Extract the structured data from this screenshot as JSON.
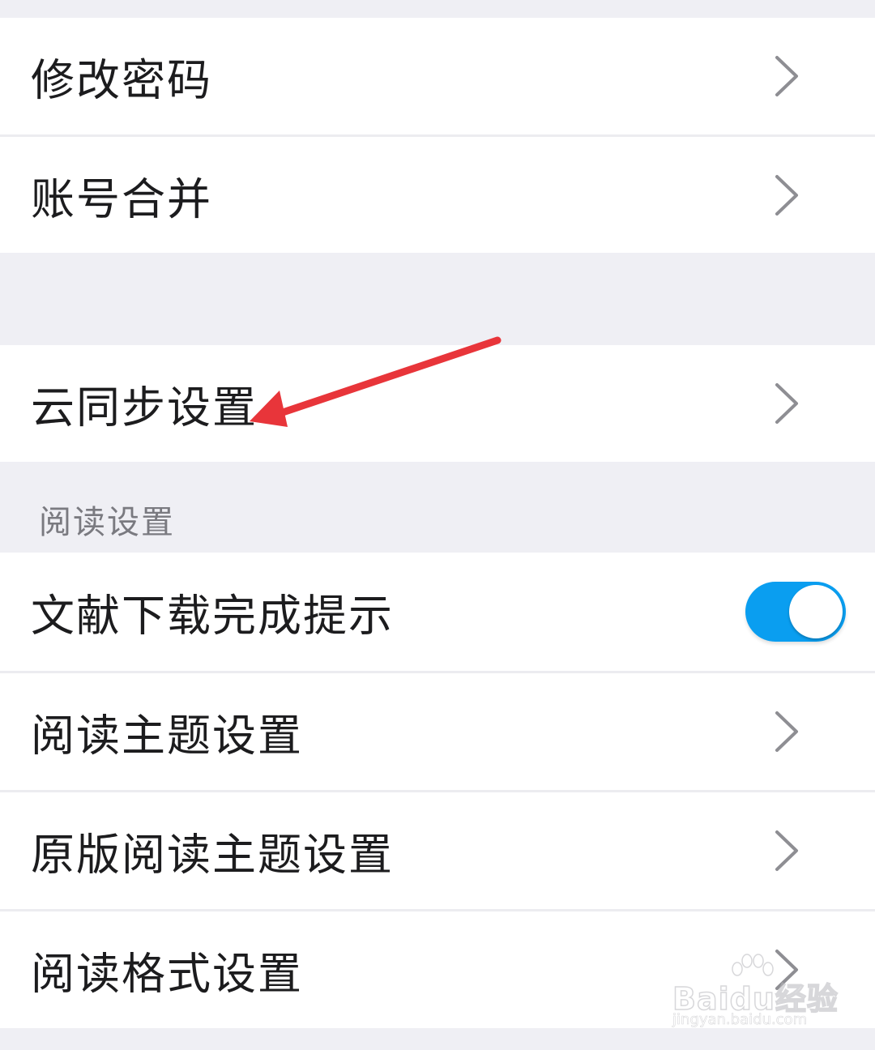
{
  "settings_list": {
    "account_items": [
      {
        "label": "修改密码"
      },
      {
        "label": "账号合并"
      }
    ],
    "cloud_sync_item": {
      "label": "云同步设置"
    },
    "reading_section": {
      "title": "阅读设置",
      "download_notify": {
        "label": "文献下载完成提示",
        "toggle_on": true
      },
      "items": [
        {
          "label": "阅读主题设置"
        },
        {
          "label": "原版阅读主题设置"
        },
        {
          "label": "阅读格式设置"
        }
      ]
    }
  },
  "colors": {
    "toggle_on": "#0a9ef0",
    "annotation_arrow": "#e8353a",
    "background": "#efeff4"
  },
  "icons": {
    "row_chevron": "chevron-right-icon",
    "annotation": "red-arrow-icon"
  },
  "watermark": {
    "brand": "Baidu经验",
    "url": "jingyan.baidu.com"
  }
}
